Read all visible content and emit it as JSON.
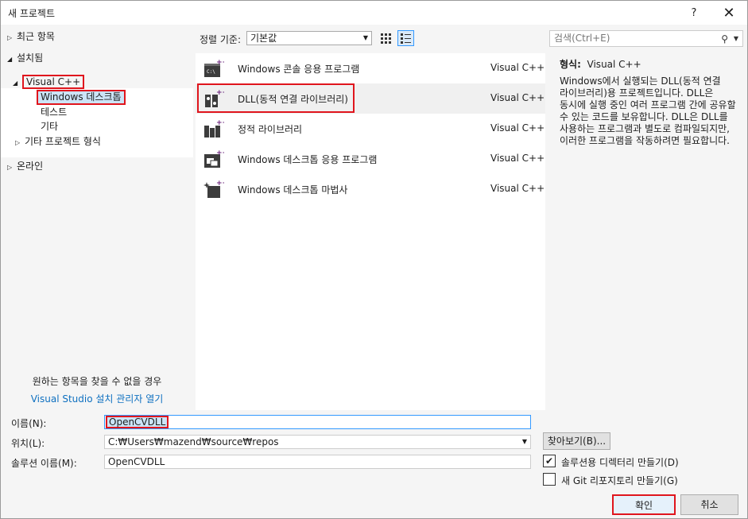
{
  "window": {
    "title": "새 프로젝트",
    "help_label": "?",
    "close_label": "✕"
  },
  "tree": {
    "recent": "최근 항목",
    "installed": "설치됨",
    "visual_cpp": "Visual C++",
    "windows_desktop": "Windows 데스크톱",
    "test": "테스트",
    "other": "기타",
    "other_project_types": "기타 프로젝트 형식",
    "online": "온라인"
  },
  "left_footer": {
    "not_found": "원하는 항목을 찾을 수 없을 경우",
    "installer_link": "Visual Studio 설치 관리자 열기"
  },
  "sort": {
    "label": "정렬 기준:",
    "value": "기본값"
  },
  "search": {
    "placeholder": "검색(Ctrl+E)"
  },
  "templates": [
    {
      "name": "Windows 콘솔 응용 프로그램",
      "lang": "Visual C++",
      "icon": "console-app-icon"
    },
    {
      "name": "DLL(동적 연결 라이브러리)",
      "lang": "Visual C++",
      "icon": "dll-icon"
    },
    {
      "name": "정적 라이브러리",
      "lang": "Visual C++",
      "icon": "static-library-icon"
    },
    {
      "name": "Windows 데스크톱 응용 프로그램",
      "lang": "Visual C++",
      "icon": "desktop-app-icon"
    },
    {
      "name": "Windows 데스크톱 마법사",
      "lang": "Visual C++",
      "icon": "desktop-wizard-icon"
    }
  ],
  "description": {
    "type_label": "형식:",
    "type_value": "Visual C++",
    "text": "Windows에서 실행되는 DLL(동적 연결 라이브러리)용 프로젝트입니다. DLL은 동시에 실행 중인 여러 프로그램 간에 공유할 수 있는 코드를 보유합니다. DLL은 DLL를 사용하는 프로그램과 별도로 컴파일되지만, 이러한 프로그램을 작동하려면 필요합니다."
  },
  "form": {
    "name_label": "이름(N):",
    "name_value": "OpenCVDLL",
    "location_label": "위치(L):",
    "location_value": "C:₩Users₩mazend₩source₩repos",
    "solution_label": "솔루션 이름(M):",
    "solution_value": "OpenCVDLL",
    "browse_label": "찾아보기(B)...",
    "create_dir_label": "솔루션용 디렉터리 만들기(D)",
    "create_dir_checked": true,
    "git_label": "새 Git 리포지토리 만들기(G)",
    "git_checked": false,
    "ok_label": "확인",
    "cancel_label": "취소"
  }
}
